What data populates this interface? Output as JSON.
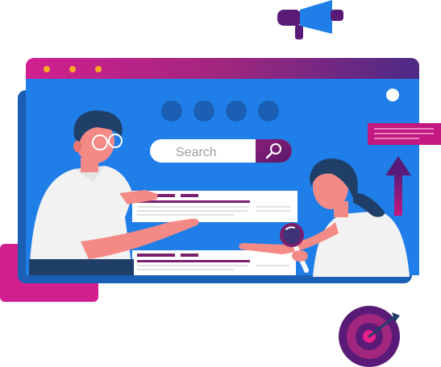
{
  "search": {
    "placeholder": "Search",
    "icon": "magnifier-icon"
  },
  "browser": {
    "traffic_lights": [
      "dot",
      "dot",
      "dot"
    ],
    "nav_circles": 4
  },
  "colors": {
    "window_blue": "#1f7ee8",
    "window_blue_dark": "#1a5fb4",
    "header_magenta": "#d11f8f",
    "header_purple": "#5a2a8f",
    "accent_purple": "#7a1f6e",
    "accent_pink": "#e91e8c",
    "skin": "#f48a86",
    "hair_dark": "#1f3f68",
    "shirt": "#f2f2f2"
  },
  "icons": {
    "megaphone": "megaphone-icon",
    "target": "target-icon",
    "arrow_up": "arrow-up-icon",
    "magnifying_glass": "magnifying-glass-icon"
  }
}
